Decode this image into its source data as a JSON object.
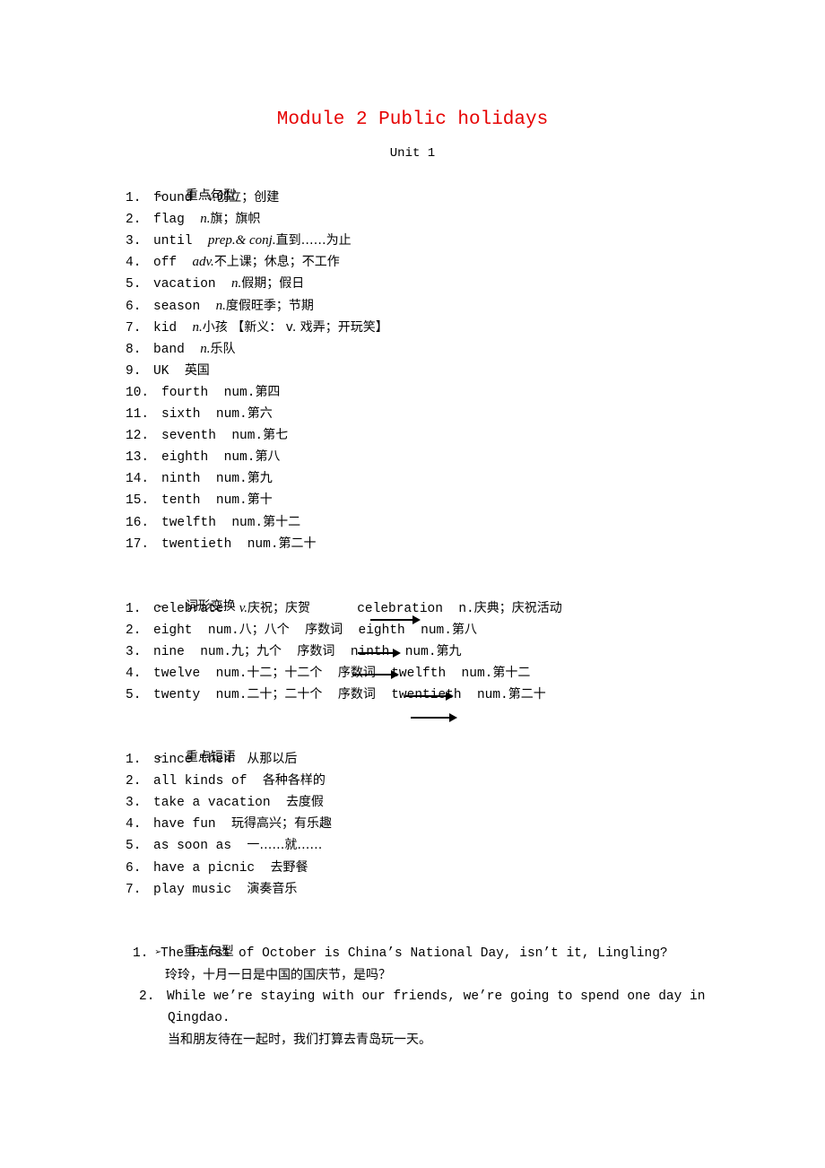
{
  "title": "Module 2  Public holidays",
  "unit": "Unit 1",
  "bullet_glyph": "➢",
  "sections": {
    "vocab": {
      "heading": "重点句型",
      "items": [
        {
          "n": "1.",
          "word": "found",
          "pos": "v.",
          "meaning": "创立；创建"
        },
        {
          "n": "2.",
          "word": "flag",
          "pos": "n.",
          "meaning": "旗；旗帜"
        },
        {
          "n": "3.",
          "word": "until",
          "pos": "prep.& conj.",
          "meaning": "直到……为止"
        },
        {
          "n": "4.",
          "word": "off",
          "pos": "adv.",
          "meaning": "不上课；休息；不工作"
        },
        {
          "n": "5.",
          "word": "vacation",
          "pos": "n.",
          "meaning": "假期；假日"
        },
        {
          "n": "6.",
          "word": "season",
          "pos": "n.",
          "meaning": "度假旺季；节期"
        },
        {
          "n": "7.",
          "word": "kid",
          "pos": "n.",
          "meaning": "小孩 【新义： v. 戏弄；开玩笑】"
        },
        {
          "n": "8.",
          "word": "band",
          "pos": "n.",
          "meaning": "乐队"
        },
        {
          "n": "9.",
          "word": "UK",
          "pos": "",
          "meaning": "英国"
        },
        {
          "n": "10.",
          "word": "fourth",
          "pos": "num.",
          "meaning": "第四"
        },
        {
          "n": "11.",
          "word": "sixth",
          "pos": "num.",
          "meaning": "第六"
        },
        {
          "n": "12.",
          "word": "seventh",
          "pos": "num.",
          "meaning": "第七"
        },
        {
          "n": "13.",
          "word": "eighth",
          "pos": "num.",
          "meaning": "第八"
        },
        {
          "n": "14.",
          "word": "ninth",
          "pos": "num.",
          "meaning": "第九"
        },
        {
          "n": "15.",
          "word": "tenth",
          "pos": "num.",
          "meaning": "第十"
        },
        {
          "n": "16.",
          "word": "twelfth",
          "pos": "num.",
          "meaning": "第十二"
        },
        {
          "n": "17.",
          "word": "twentieth",
          "pos": "num.",
          "meaning": "第二十"
        }
      ]
    },
    "word_forms": {
      "heading": "词形变换",
      "items": [
        {
          "n": "1.",
          "text": "celebrate",
          "pos": "v.",
          "rest": "庆祝；庆贺      celebration  n.庆典；庆祝活动"
        },
        {
          "n": "2.",
          "text": "eight  num.八；八个  序数词  eighth  num.第八"
        },
        {
          "n": "3.",
          "text": "nine  num.九；九个  序数词  ninth  num.第九"
        },
        {
          "n": "4.",
          "text": "twelve  num.十二；十二个  序数词  twelfth  num.第十二"
        },
        {
          "n": "5.",
          "text": "twenty  num.二十；二十个  序数词  twentieth  num.第二十"
        }
      ]
    },
    "phrases": {
      "heading": "重点短语",
      "items": [
        {
          "n": "1.",
          "en": "since then",
          "cn": "从那以后"
        },
        {
          "n": "2.",
          "en": "all kinds of",
          "cn": "各种各样的"
        },
        {
          "n": "3.",
          "en": "take a vacation",
          "cn": "去度假"
        },
        {
          "n": "4.",
          "en": "have fun",
          "cn": "玩得高兴；有乐趣"
        },
        {
          "n": "5.",
          "en": "as soon as",
          "cn": "一……就……"
        },
        {
          "n": "6.",
          "en": "have a picnic",
          "cn": "去野餐"
        },
        {
          "n": "7.",
          "en": "play music",
          "cn": "演奏音乐"
        }
      ]
    },
    "sentences": {
      "heading": "重点句型",
      "items": [
        {
          "n": "1.",
          "en": "The First of October is China’s National Day, isn’t it, Lingling?",
          "cn": "玲玲，十月一日是中国的国庆节，是吗？"
        },
        {
          "n": "2.",
          "en": "While we’re staying with our friends, we’re going to spend one day in",
          "en2": "Qingdao.",
          "cn": "当和朋友待在一起时，我们打算去青岛玩一天。"
        }
      ]
    }
  }
}
